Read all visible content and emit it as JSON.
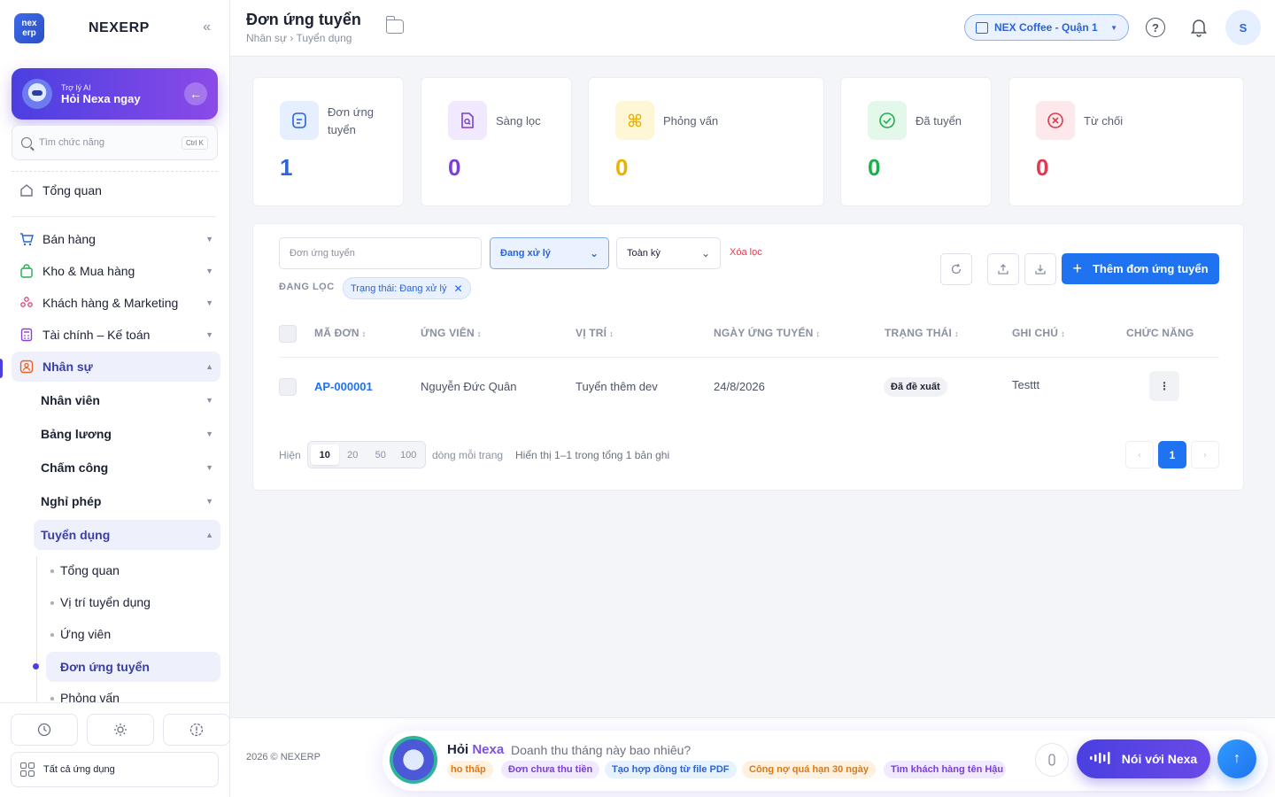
{
  "sidebar": {
    "brand": "NEXERP",
    "logo_top": "nex",
    "logo_bottom": "erp",
    "ai_label": "Trợ lý AI",
    "ai_cta": "Hỏi Nexa ngay",
    "search_placeholder": "Tìm chức năng",
    "search_shortcut": "Ctrl K",
    "overview": "Tổng quan",
    "sections": [
      {
        "label": "Bán hàng"
      },
      {
        "label": "Kho & Mua hàng"
      },
      {
        "label": "Khách hàng & Marketing"
      },
      {
        "label": "Tài chính – Kế toán"
      },
      {
        "label": "Nhân sự"
      }
    ],
    "hr_items": [
      {
        "label": "Nhân viên"
      },
      {
        "label": "Bảng lương"
      },
      {
        "label": "Chấm công"
      },
      {
        "label": "Nghỉ phép"
      },
      {
        "label": "Tuyển dụng"
      }
    ],
    "recruit_items": [
      {
        "label": "Tổng quan"
      },
      {
        "label": "Vị trí tuyển dụng"
      },
      {
        "label": "Ứng viên"
      },
      {
        "label": "Đơn ứng tuyển"
      },
      {
        "label": "Phỏng vấn"
      }
    ],
    "all_apps": "Tất cả ứng dụng"
  },
  "header": {
    "title": "Đơn ứng tuyển",
    "breadcrumb": "Nhân sự › Tuyển dụng",
    "store": "NEX Coffee - Quận 1",
    "help_glyph": "?",
    "avatar_initial": "S"
  },
  "stats": [
    {
      "label": "Đơn ứng tuyển",
      "value": "1",
      "color": "#2c63d8",
      "bg": "#e6efff"
    },
    {
      "label": "Sàng lọc",
      "value": "0",
      "color": "#7a3fd8",
      "bg": "#f1e9ff"
    },
    {
      "label": "Phỏng vấn",
      "value": "0",
      "color": "#e8b400",
      "bg": "#fff6d6"
    },
    {
      "label": "Đã tuyển",
      "value": "0",
      "color": "#1fae4f",
      "bg": "#e3f7ea"
    },
    {
      "label": "Từ chối",
      "value": "0",
      "color": "#e13a4f",
      "bg": "#fde8eb"
    }
  ],
  "filters": {
    "search_placeholder": "Đơn ứng tuyển",
    "status": "Đang xử lý",
    "period": "Toàn kỳ",
    "clear": "Xóa lọc",
    "active_label": "ĐANG LỌC",
    "chip": "Trạng thái: Đang xử lý"
  },
  "actions": {
    "add": "Thêm đơn ứng tuyển"
  },
  "table": {
    "columns": [
      "MÃ ĐƠN",
      "ỨNG VIÊN",
      "VỊ TRÍ",
      "NGÀY ỨNG TUYỂN",
      "TRẠNG THÁI",
      "GHI CHÚ",
      "CHỨC NĂNG"
    ],
    "rows": [
      {
        "code": "AP-000001",
        "candidate": "Nguyễn Đức Quân",
        "position": "Tuyển thêm dev",
        "date": "24/8/2026",
        "status": "Đã đề xuất",
        "note": "Testtt"
      }
    ]
  },
  "pagination": {
    "show": "Hiện",
    "sizes": [
      "10",
      "20",
      "50",
      "100"
    ],
    "per_page": "dòng mỗi trang",
    "summary": "Hiển thị 1–1 trong tổng 1 bản ghi",
    "current": "1"
  },
  "footer": {
    "copyright": "2026 © NEXERP",
    "ask": "Hỏi",
    "ask_brand": "Nexa",
    "placeholder": "Doanh thu tháng này bao nhiêu?",
    "suggestions": [
      {
        "label": "ho thấp"
      },
      {
        "label": "Đơn chưa thu tiền"
      },
      {
        "label": "Tạo hợp đồng từ file PDF"
      },
      {
        "label": "Công nợ quá hạn 30 ngày"
      },
      {
        "label": "Tìm khách hàng tên Hậu"
      }
    ],
    "talk": "Nói với Nexa"
  }
}
